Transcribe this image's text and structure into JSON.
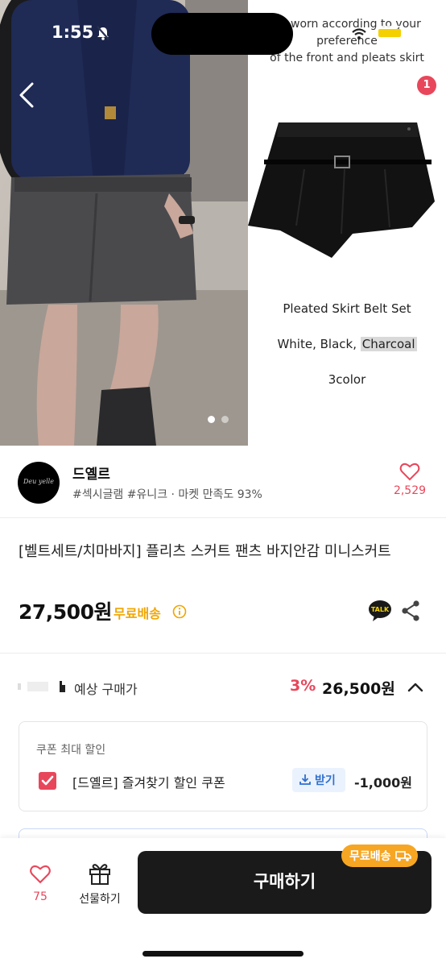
{
  "status_bar": {
    "time": "1:55"
  },
  "hero": {
    "caption_top": [
      "be worn according to your",
      "preference",
      "of the front and pleats skirt"
    ],
    "product_label": "Pleated Skirt Belt Set",
    "colors_prefix": "White, Black, ",
    "colors_highlight": "Charcoal",
    "color_count": "3color",
    "cart_badge": "1"
  },
  "shop": {
    "logo_text": "Deu yelle",
    "name": "드옐르",
    "tags": "#섹시글램 #유니크 · 마켓 만족도 93%",
    "like_count": "2,529"
  },
  "product": {
    "title": "[벨트세트/치마바지] 플리츠 스커트 팬츠 바지안감 미니스커트",
    "price": "27,500원",
    "free_shipping": "무료배송"
  },
  "expected": {
    "label": "예상 구매가",
    "discount": "3%",
    "price": "26,500원"
  },
  "coupon": {
    "heading": "쿠폰 최대 할인",
    "name": "[드옐르] 즐겨찾기 할인 쿠폰",
    "get_label": "받기",
    "amount": "-1,000원"
  },
  "bottom_bar": {
    "like_count": "75",
    "gift_label": "선물하기",
    "buy_label": "구매하기",
    "ship_badge": "무료배송"
  },
  "colors": {
    "accent_pink": "#e8475b",
    "free_ship_orange": "#f0a500",
    "coupon_blue": "#2f6fd0",
    "buy_button": "#1a1a1a"
  }
}
